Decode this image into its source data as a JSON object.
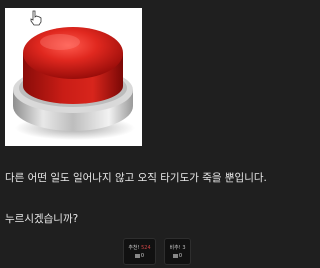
{
  "post": {
    "image_desc_icon": "big-red-button-icon",
    "line1": "다른 어떤 일도 일어나지 않고 오직 타기도가 죽을 뿐입니다.",
    "line2": "누르시겠습니까?"
  },
  "votes": {
    "recommend_label": "추천!",
    "recommend_count": "524",
    "recommend_sub": "0",
    "not_recommend_label": "비추!",
    "not_recommend_count": "3",
    "not_recommend_sub": "0"
  },
  "colors": {
    "background": "#1f1f1f",
    "button_red": "#c8201c",
    "text": "#e6e6e6"
  }
}
